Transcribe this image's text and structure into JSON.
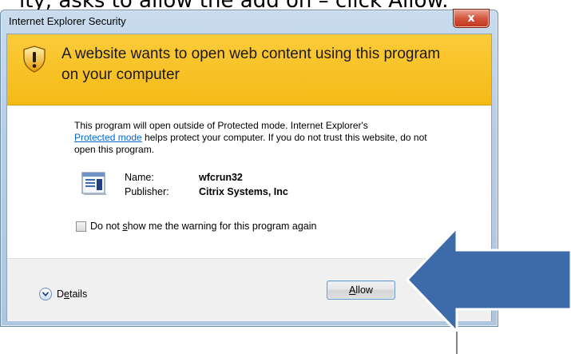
{
  "instruction": "ity, asks to allow the add on – click Allow.",
  "window": {
    "title": "Internet Explorer Security",
    "close_label": "x"
  },
  "banner": {
    "icon": "shield-warning-icon",
    "headline": "A website wants to open web content using this program on your computer"
  },
  "description": {
    "part1": "This program will open outside of Protected mode. Internet Explorer's",
    "link": "Protected mode",
    "part2": " helps protect your computer. If you do not trust this website, do not open this program."
  },
  "program": {
    "icon": "program-window-icon",
    "name_label": "Name:",
    "name_value": "wfcrun32",
    "publisher_label": "Publisher:",
    "publisher_value": "Citrix Systems, Inc"
  },
  "checkbox": {
    "checked": false,
    "label_pre": "Do not ",
    "label_accel": "s",
    "label_post": "how me the warning for this program again"
  },
  "footer": {
    "details_pre": "D",
    "details_accel": "e",
    "details_post": "tails",
    "allow_accel": "A",
    "allow_post": "llow"
  },
  "overlay": {
    "arrow_icon": "pointing-arrow-icon",
    "arrow_color": "#3d6aa8"
  }
}
